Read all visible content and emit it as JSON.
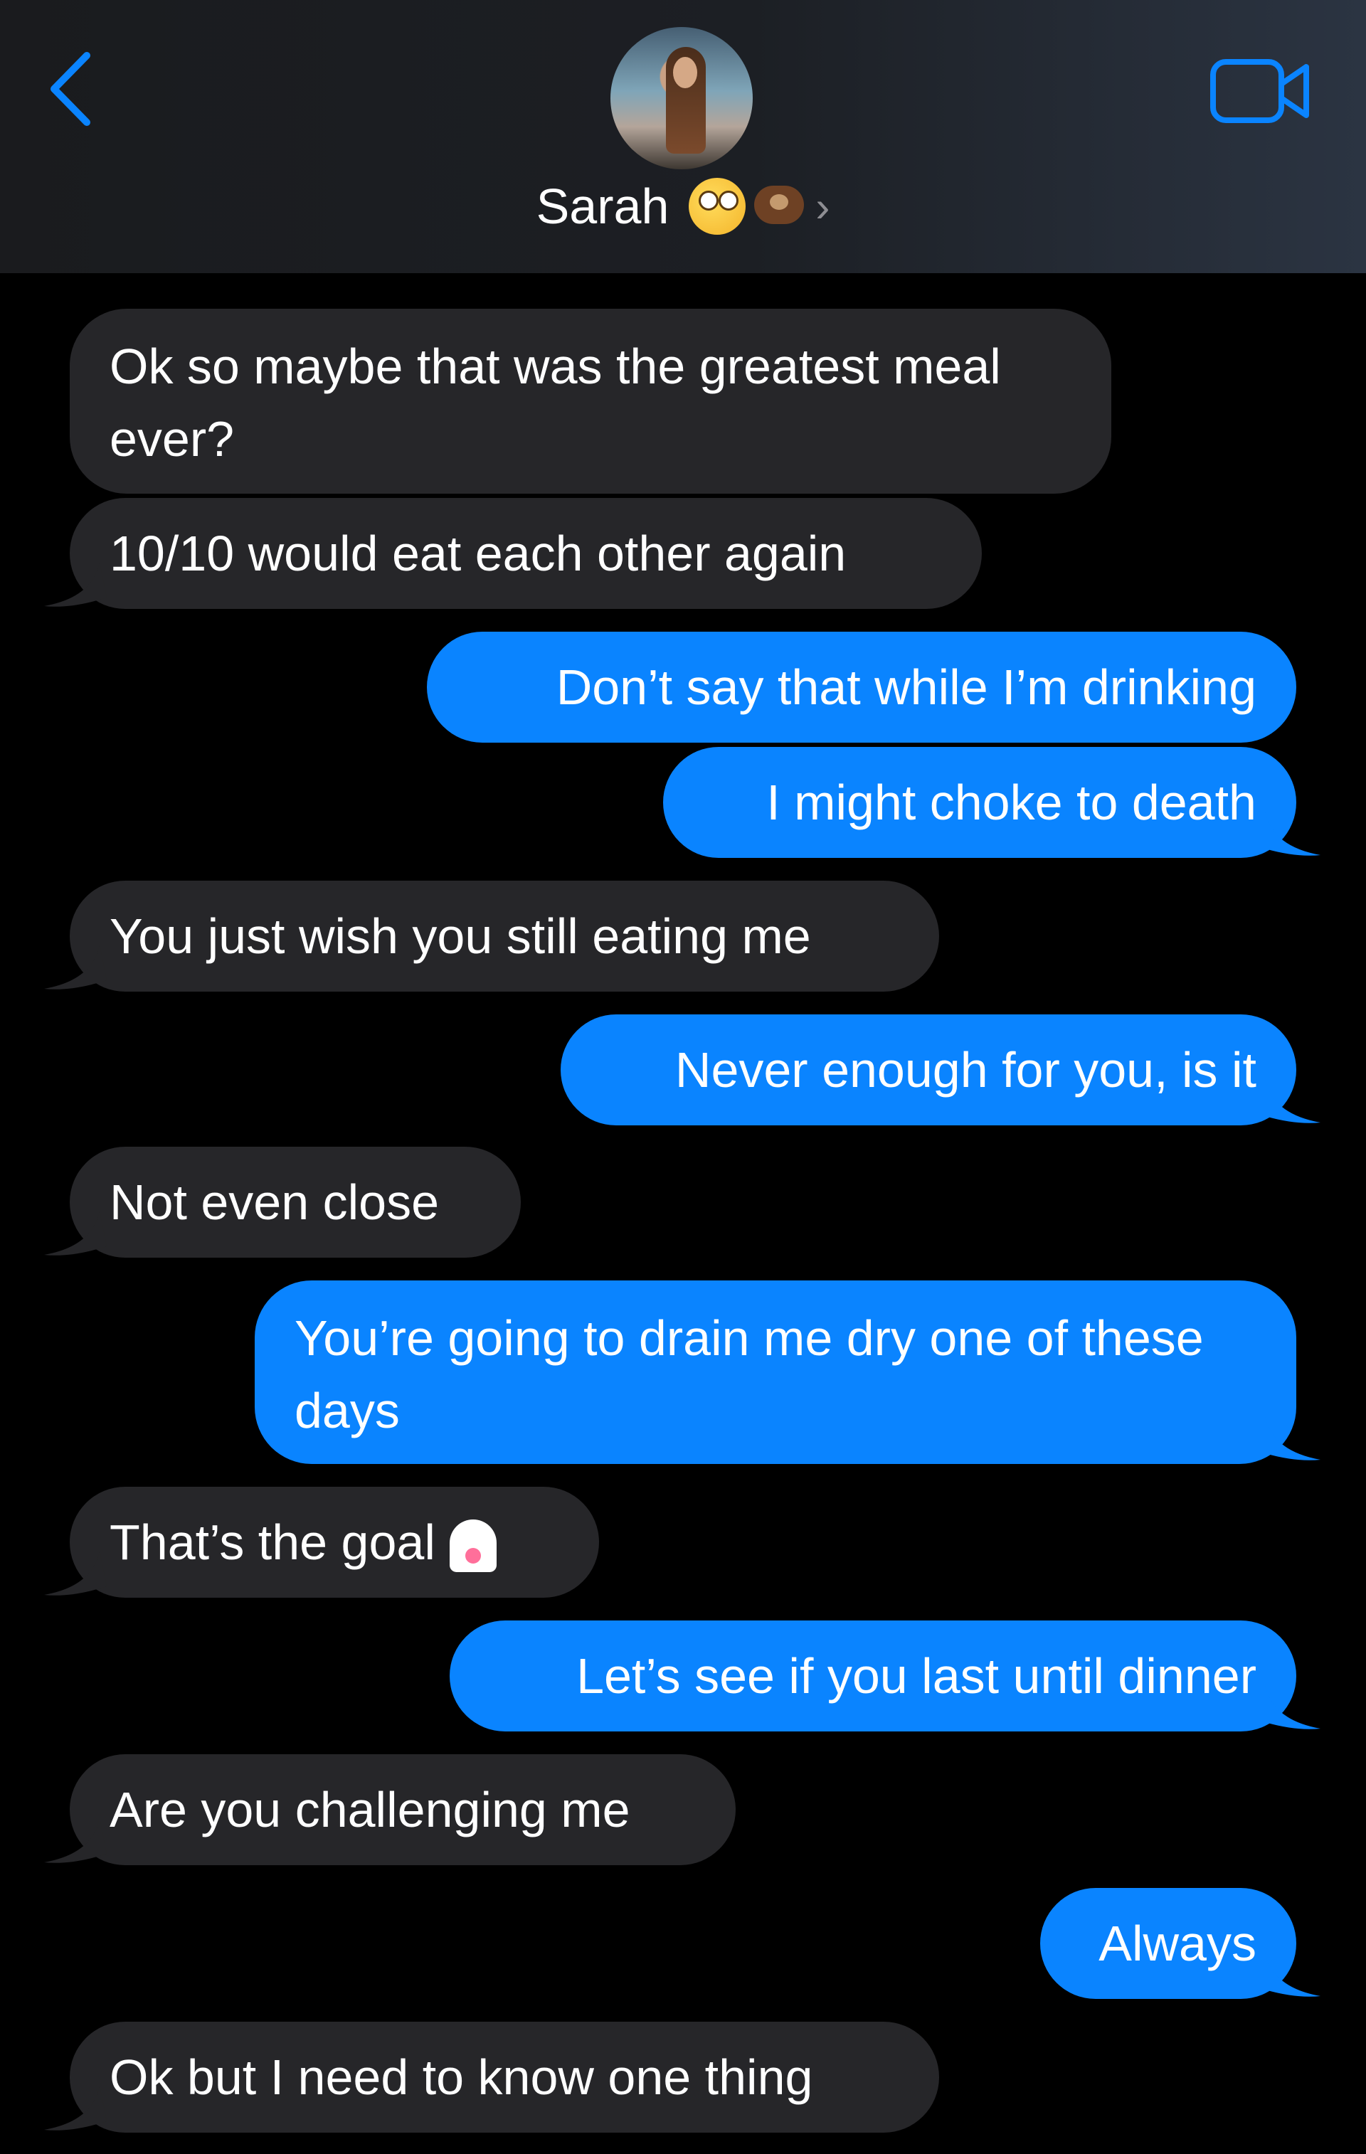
{
  "header": {
    "contact_name": "Sarah",
    "emoji_1": "rolling-eyes-emoji",
    "emoji_2": "otter-emoji",
    "chevron": "›"
  },
  "colors": {
    "incoming_bubble": "#262629",
    "outgoing_bubble": "#0a84ff",
    "accent": "#0a84ff",
    "background": "#000000"
  },
  "messages": [
    {
      "dir": "in",
      "text": "Ok so maybe that was the greatest meal ever?"
    },
    {
      "dir": "in",
      "text": "10/10 would eat each other again"
    },
    {
      "dir": "out",
      "text": "Don’t say that while I’m drinking"
    },
    {
      "dir": "out",
      "text": "I might choke to death"
    },
    {
      "dir": "in",
      "text": "You just wish you still eating me"
    },
    {
      "dir": "out",
      "text": "Never enough for you, is it"
    },
    {
      "dir": "in",
      "text": "Not even close"
    },
    {
      "dir": "out",
      "text": "You’re going to drain me dry one of these days"
    },
    {
      "dir": "in",
      "text": "That’s the goal",
      "emoji": "ghost-emoji"
    },
    {
      "dir": "out",
      "text": "Let’s see if you last until dinner"
    },
    {
      "dir": "in",
      "text": "Are you challenging me"
    },
    {
      "dir": "out",
      "text": "Always"
    },
    {
      "dir": "in",
      "text": "Ok but I need to know one thing"
    }
  ]
}
